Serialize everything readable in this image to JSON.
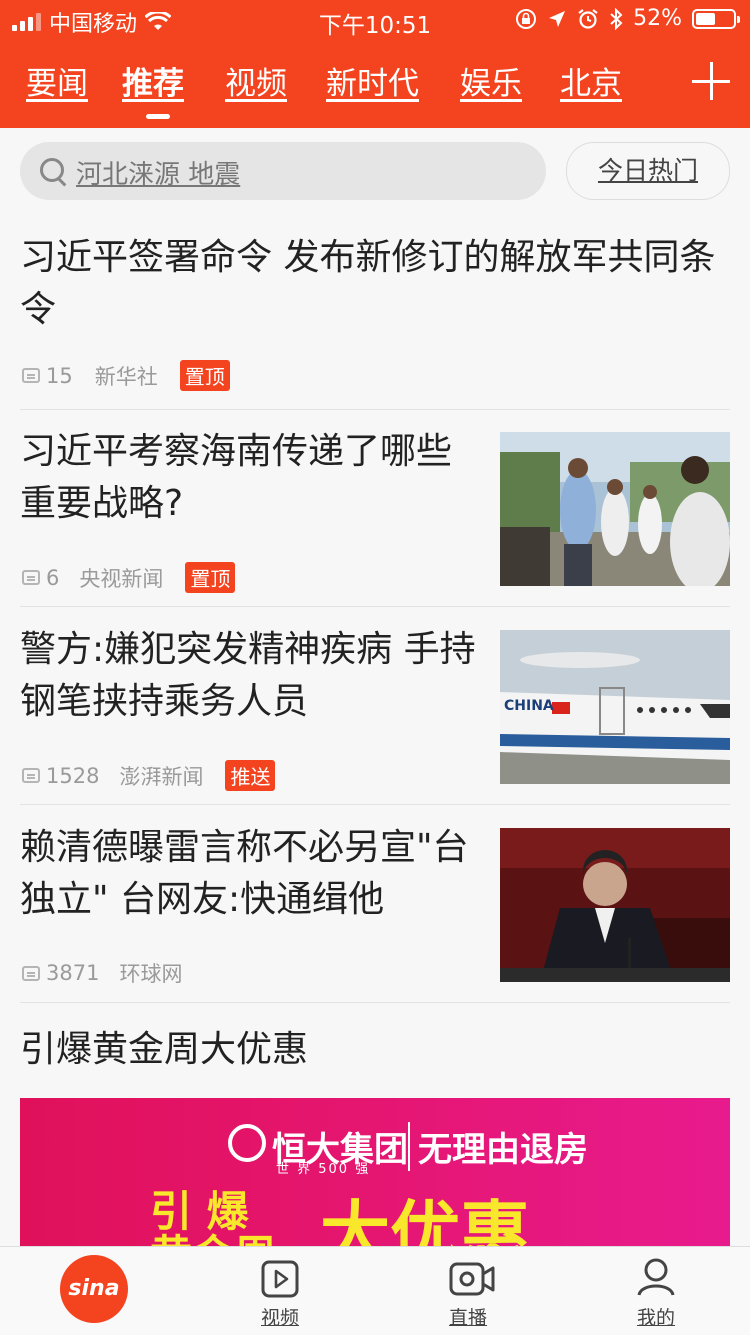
{
  "status_bar": {
    "carrier": "中国移动",
    "time": "下午10:51",
    "battery": "52%",
    "battery_level": 0.52
  },
  "channel_tabs": [
    {
      "label": "要闻",
      "active": false
    },
    {
      "label": "推荐",
      "active": true
    },
    {
      "label": "视频",
      "active": false
    },
    {
      "label": "新时代",
      "active": false
    },
    {
      "label": "娱乐",
      "active": false
    },
    {
      "label": "北京",
      "active": false
    }
  ],
  "search": {
    "placeholder": "河北涞源 地震",
    "hot_button": "今日热门"
  },
  "articles": [
    {
      "title": "习近平签署命令 发布新修订的解放军共同条令",
      "comments": "15",
      "source": "新华社",
      "badge": "置顶"
    },
    {
      "title": "习近平考察海南传递了哪些重要战略?",
      "comments": "6",
      "source": "央视新闻",
      "badge": "置顶"
    },
    {
      "title": "警方:嫌犯突发精神疾病 手持钢笔挟持乘务人员",
      "comments": "1528",
      "source": "澎湃新闻",
      "badge": "推送"
    },
    {
      "title": "赖清德曝雷言称不必另宣\"台独立\" 台网友:快通缉他",
      "comments": "3871",
      "source": "环球网",
      "badge": ""
    }
  ],
  "ad": {
    "title": "引爆黄金周大优惠",
    "brand": "恒大集团",
    "brand_sub": "世 界 500 强",
    "slogan": "无理由退房",
    "big_text": "大优惠",
    "left_text_1": "引 爆",
    "left_text_2": "黄金周"
  },
  "bottom_nav": [
    {
      "label": "",
      "icon": "sina-logo-icon"
    },
    {
      "label": "视频",
      "icon": "video-play-icon"
    },
    {
      "label": "直播",
      "icon": "live-camera-icon"
    },
    {
      "label": "我的",
      "icon": "user-icon"
    }
  ],
  "colors": {
    "accent": "#f4431f",
    "ad_pink": "#e4156c",
    "ad_yellow": "#f8e72b"
  }
}
